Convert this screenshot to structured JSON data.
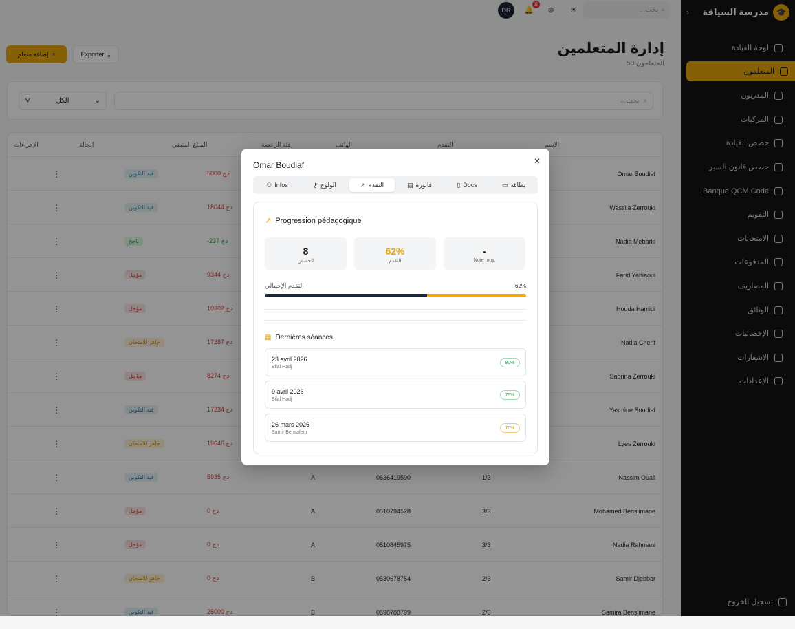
{
  "app": {
    "name": "مدرسة السياقة"
  },
  "topbar": {
    "search_placeholder": "بحث...",
    "avatar": "DR",
    "notif_count": "99"
  },
  "sidebar": {
    "items": [
      {
        "label": "لوحة القيادة"
      },
      {
        "label": "المتعلمون",
        "active": true
      },
      {
        "label": "المدربون"
      },
      {
        "label": "المركبات"
      },
      {
        "label": "حصص القيادة"
      },
      {
        "label": "حصص قانون السير"
      },
      {
        "label": "Banque QCM Code"
      },
      {
        "label": "التقويم"
      },
      {
        "label": "الامتحانات"
      },
      {
        "label": "المدفوعات"
      },
      {
        "label": "المصاريف"
      },
      {
        "label": "الوثائق"
      },
      {
        "label": "الإحصائيات"
      },
      {
        "label": "الإشعارات"
      },
      {
        "label": "الإعدادات"
      }
    ],
    "logout": "تسجيل الخروج"
  },
  "page": {
    "title": "إدارة المتعلمين",
    "subtitle": "50 المتعلمون",
    "add_label": "إضافة متعلم",
    "export_label": "Exporter"
  },
  "filters": {
    "search_placeholder": "بحث...",
    "select_value": "الكل"
  },
  "table": {
    "headers": {
      "actions": "الإجراءات",
      "status": "الحالة",
      "remaining": "المبلغ المتبقي",
      "category": "فئة الرخصة",
      "phone": "الهاتف",
      "progress": "التقدم",
      "name": "الاسم"
    },
    "rows": [
      {
        "name": "Omar Boudiaf",
        "status": "قيد التكوين",
        "st": "blue",
        "amount": "5000 دج",
        "cat": "",
        "phone": "",
        "prog": ""
      },
      {
        "name": "Wassila Zerrouki",
        "status": "قيد التكوين",
        "st": "blue",
        "amount": "18044 دج",
        "cat": "",
        "phone": "",
        "prog": ""
      },
      {
        "name": "Nadia Mebarki",
        "status": "ناجح",
        "st": "green",
        "amount": "-237 دج",
        "cat": "",
        "phone": "",
        "prog": ""
      },
      {
        "name": "Farid Yahiaoui",
        "status": "مؤجل",
        "st": "red",
        "amount": "9344 دج",
        "cat": "",
        "phone": "",
        "prog": ""
      },
      {
        "name": "Houda Hamidi",
        "status": "مؤجل",
        "st": "red",
        "amount": "10302 دج",
        "cat": "",
        "phone": "",
        "prog": ""
      },
      {
        "name": "Nadia Cherif",
        "status": "جاهز للامتحان",
        "st": "amber",
        "amount": "17287 دج",
        "cat": "",
        "phone": "",
        "prog": ""
      },
      {
        "name": "Sabrina Zerrouki",
        "status": "مؤجل",
        "st": "red",
        "amount": "8274 دج",
        "cat": "",
        "phone": "",
        "prog": ""
      },
      {
        "name": "Yasmine Boudiaf",
        "status": "قيد التكوين",
        "st": "blue",
        "amount": "17234 دج",
        "cat": "",
        "phone": "",
        "prog": ""
      },
      {
        "name": "Lyes Zerrouki",
        "status": "جاهز للامتحان",
        "st": "amber",
        "amount": "19646 دج",
        "cat": "",
        "phone": "",
        "prog": ""
      },
      {
        "name": "Nassim Ouali",
        "status": "قيد التكوين",
        "st": "blue",
        "amount": "5935 دج",
        "cat": "A",
        "phone": "0636419590",
        "prog": "1/3"
      },
      {
        "name": "Mohamed Benslimane",
        "status": "مؤجل",
        "st": "red",
        "amount": "0 دج",
        "cat": "A",
        "phone": "0510794528",
        "prog": "3/3"
      },
      {
        "name": "Nadia Rahmani",
        "status": "مؤجل",
        "st": "red",
        "amount": "0 دج",
        "cat": "A",
        "phone": "0510845975",
        "prog": "3/3"
      },
      {
        "name": "Samir Djebbar",
        "status": "جاهز للامتحان",
        "st": "amber",
        "amount": "0 دج",
        "cat": "B",
        "phone": "0530678754",
        "prog": "2/3"
      },
      {
        "name": "Samira Benslimane",
        "status": "قيد التكوين",
        "st": "blue",
        "amount": "25000 دج",
        "cat": "B",
        "phone": "0598788799",
        "prog": "2/3"
      }
    ]
  },
  "modal": {
    "title": "Omar Boudiaf",
    "tabs": [
      "Infos",
      "الولوج",
      "التقدم",
      "فاتورة",
      "Docs",
      "بطاقة"
    ],
    "section_title": "Progression pédagogique",
    "stats": [
      {
        "value": "8",
        "label": "الحصص"
      },
      {
        "value": "62%",
        "label": "التقدم"
      },
      {
        "value": "-",
        "label": "Note moy."
      }
    ],
    "overall_label": "التقدم الإجمالي",
    "overall_value": "62%",
    "overall_fraction": 0.62,
    "sessions_title": "Dernières séances",
    "sessions": [
      {
        "date": "23 avril 2026",
        "instructor": "Bilal Hadj",
        "score": "80%",
        "color": "green"
      },
      {
        "date": "9 avril 2026",
        "instructor": "Bilal Hadj",
        "score": "75%",
        "color": "green"
      },
      {
        "date": "26 mars 2026",
        "instructor": "Samir Bensalem",
        "score": "70%",
        "color": "amber"
      }
    ]
  },
  "colors": {
    "accent": "#e6a50d",
    "dark": "#1c2536",
    "sidebar_bg": "#131313"
  }
}
